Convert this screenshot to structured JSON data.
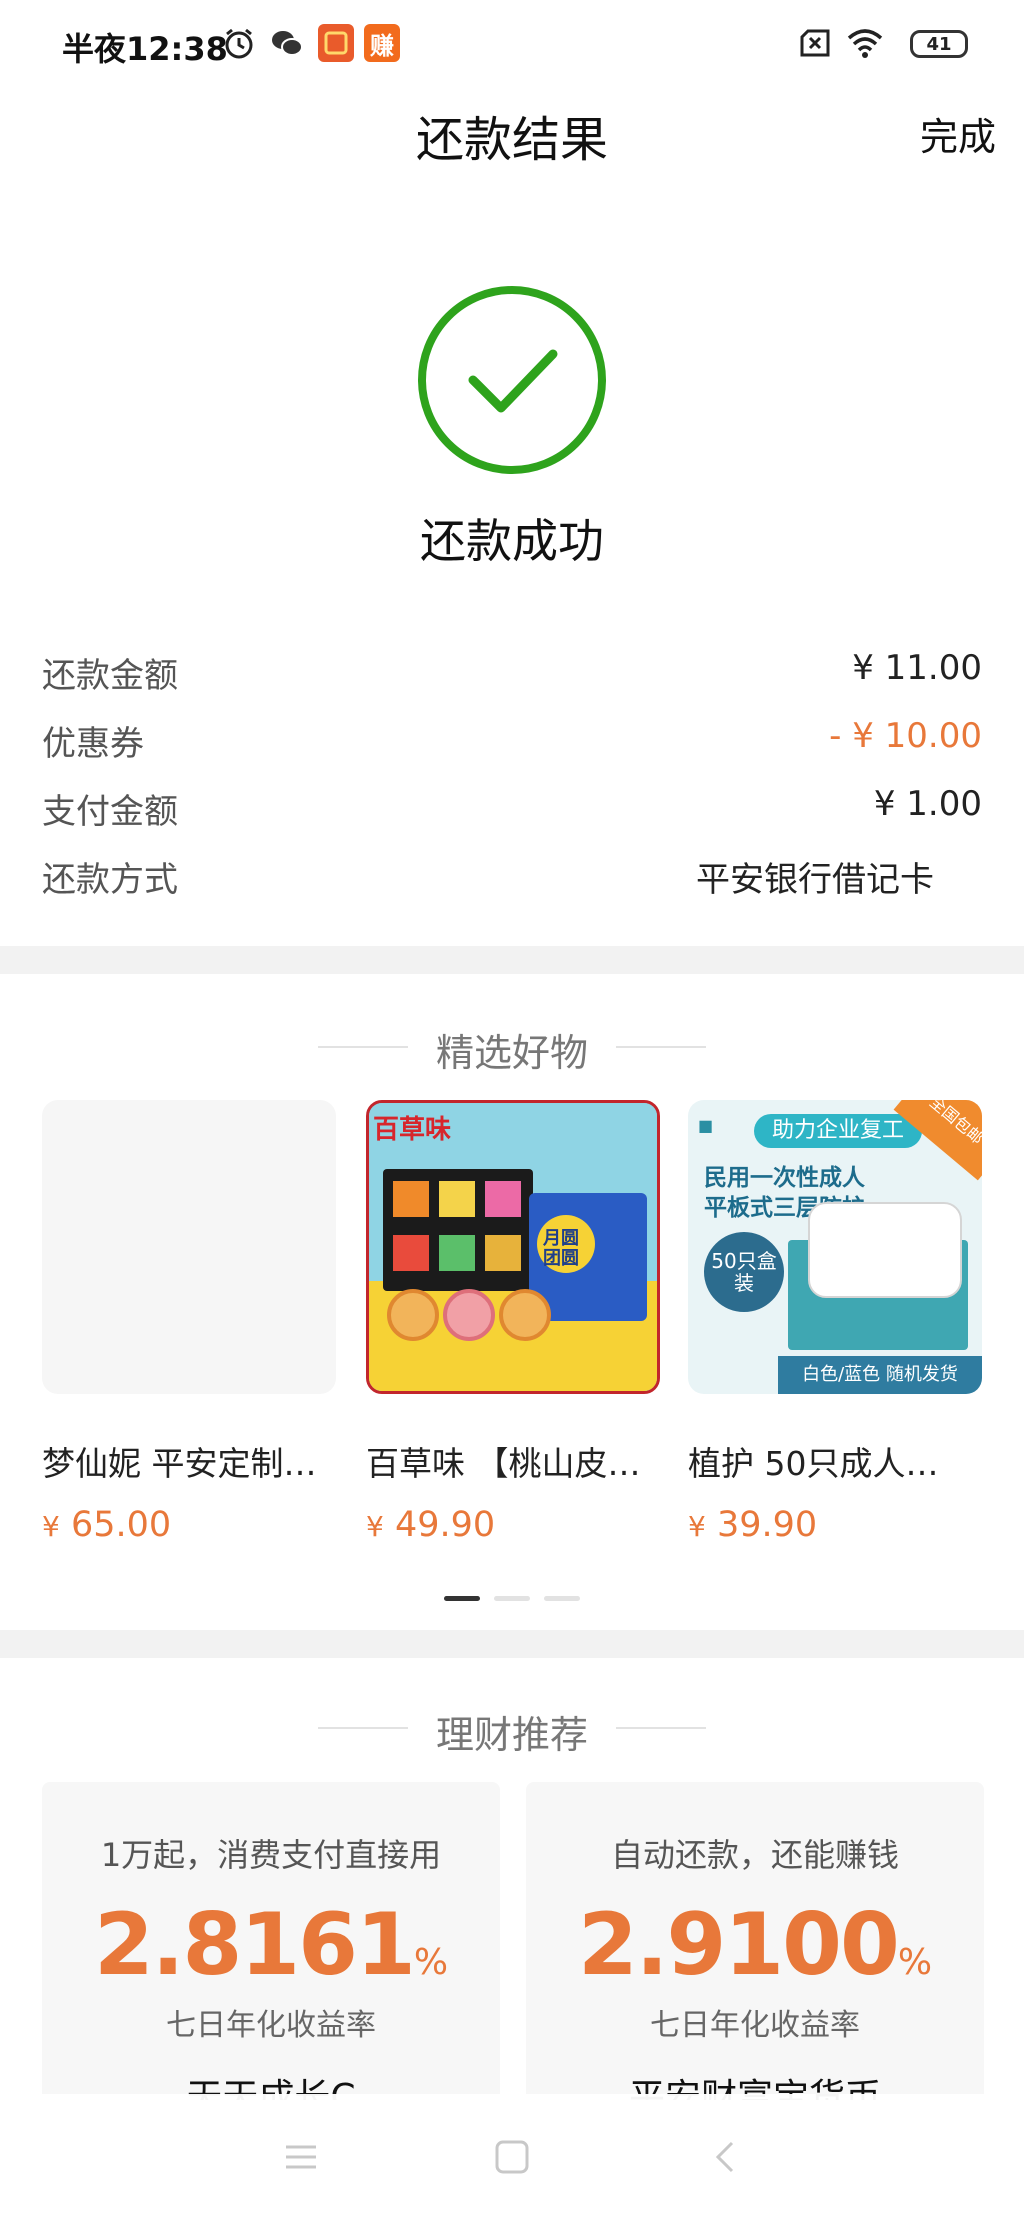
{
  "status_bar": {
    "time": "半夜12:38",
    "battery": "41",
    "badge_1": "赚"
  },
  "header": {
    "title": "还款结果",
    "done_label": "完成"
  },
  "result": {
    "status_text": "还款成功"
  },
  "details": [
    {
      "label": "还款金额",
      "value": "¥ 11.00"
    },
    {
      "label": "优惠券",
      "value": "- ¥ 10.00"
    },
    {
      "label": "支付金额",
      "value": "¥ 1.00"
    },
    {
      "label": "还款方式",
      "value": "平安银行借记卡"
    }
  ],
  "picks": {
    "title": "精选好物",
    "products": [
      {
        "name": "梦仙妮 平安定制…",
        "price_symbol": "¥",
        "price": "65.00"
      },
      {
        "name": "百草味 【桃山皮…",
        "price_symbol": "¥",
        "price": "49.90",
        "image_brand": "百草味",
        "image_label": "月圆团圆"
      },
      {
        "name": "植护 50只成人…",
        "price_symbol": "¥",
        "price": "39.90",
        "image_header": "助力企业复工",
        "image_line1": "民用一次性成人",
        "image_line2": "平板式三层防护",
        "image_count": "50只盒装",
        "image_footer": "白色/蓝色 随机发货",
        "image_corner": "全国包邮"
      }
    ]
  },
  "finance": {
    "title": "理财推荐",
    "cards": [
      {
        "subtitle": "1万起，消费支付直接用",
        "rate": "2.8161",
        "unit": "%",
        "note": "七日年化收益率",
        "name": "天天成长C"
      },
      {
        "subtitle": "自动还款，还能赚钱",
        "rate": "2.9100",
        "unit": "%",
        "note": "七日年化收益率",
        "name": "平安财富宝货币"
      }
    ]
  },
  "nav": {
    "icons": [
      "menu-icon",
      "home-square-icon",
      "back-icon"
    ]
  },
  "colors": {
    "accent": "#e8783a",
    "success": "#2ea31c"
  }
}
